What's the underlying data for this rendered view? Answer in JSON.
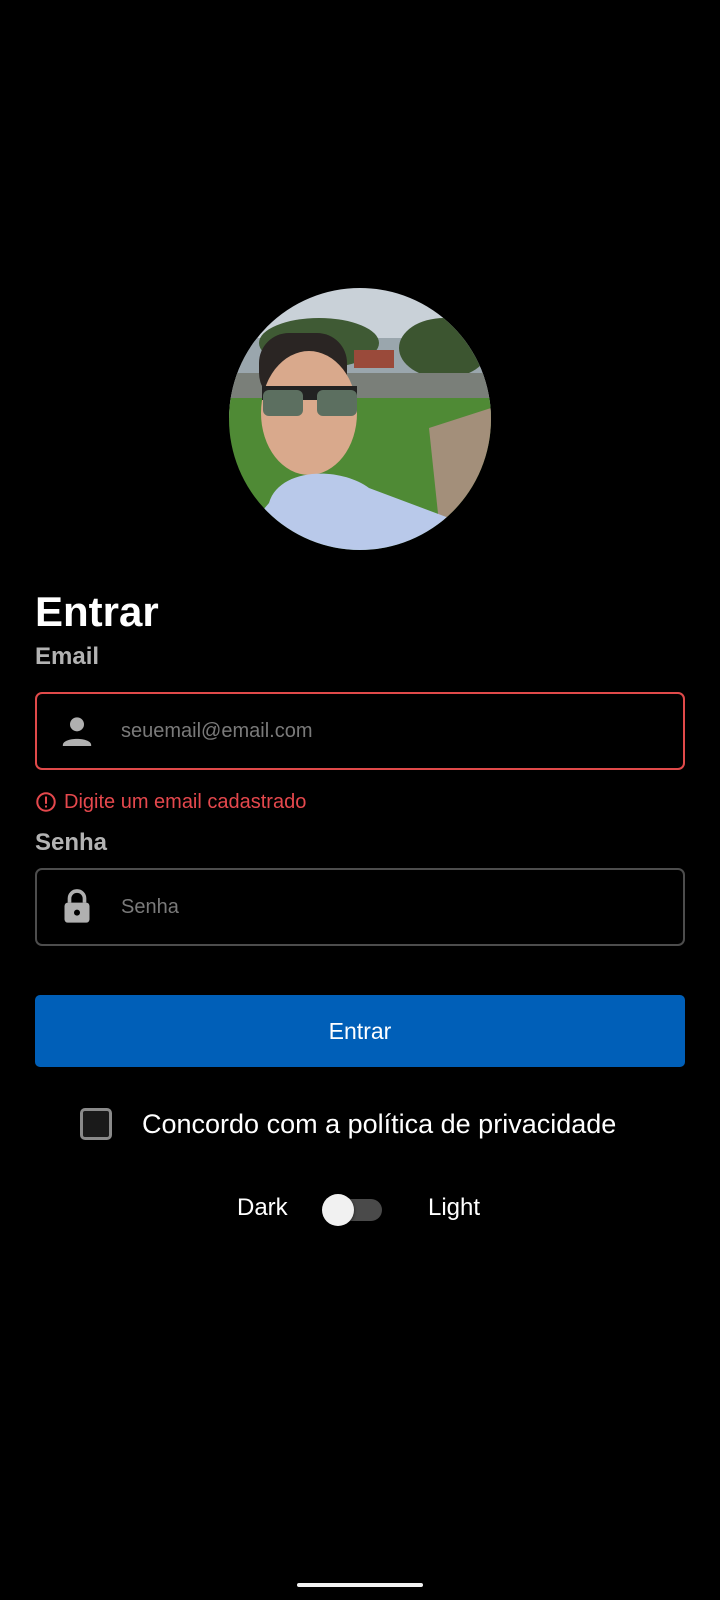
{
  "login": {
    "title": "Entrar",
    "email_label": "Email",
    "email_placeholder": "seuemail@email.com",
    "email_value": "",
    "email_error": "Digite um email cadastrado",
    "password_label": "Senha",
    "password_placeholder": "Senha",
    "password_value": "",
    "submit_label": "Entrar",
    "privacy_label": "Concordo com a política de privacidade",
    "privacy_checked": false
  },
  "theme": {
    "dark_label": "Dark",
    "light_label": "Light",
    "toggle_on": false
  },
  "icons": {
    "email": "person-icon",
    "password": "lock-icon",
    "error": "error-circle-icon"
  },
  "colors": {
    "background": "#000000",
    "primary": "#005fb8",
    "error": "#e5484d"
  }
}
